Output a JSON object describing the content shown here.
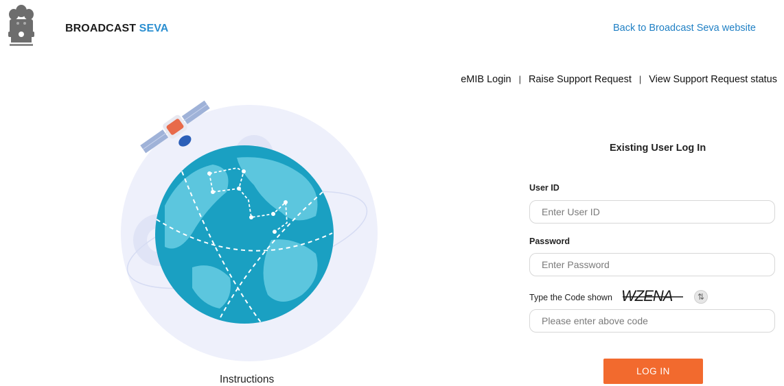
{
  "header": {
    "brand_main": "BROADCAST",
    "brand_accent": "SEVA",
    "back_link": "Back to Broadcast Seva website"
  },
  "nav": {
    "items": [
      "eMIB Login",
      "Raise Support Request",
      "View Support Request status"
    ],
    "separator": "|"
  },
  "illustration": {
    "label": "Instructions"
  },
  "login": {
    "title": "Existing User Log In",
    "user_id_label": "User ID",
    "user_id_placeholder": "Enter User ID",
    "password_label": "Password",
    "password_placeholder": "Enter Password",
    "code_label": "Type the Code shown",
    "captcha_text": "WZENA",
    "code_placeholder": "Please enter above code",
    "button_label": "LOG IN"
  },
  "colors": {
    "accent_blue": "#2b8fd1",
    "link_blue": "#1e7fc4",
    "button_orange": "#f26a2e",
    "globe_teal": "#1aa0c2"
  },
  "icons": [
    "national-emblem-icon",
    "satellite-icon",
    "globe-icon",
    "gear-icon",
    "refresh-icon"
  ]
}
